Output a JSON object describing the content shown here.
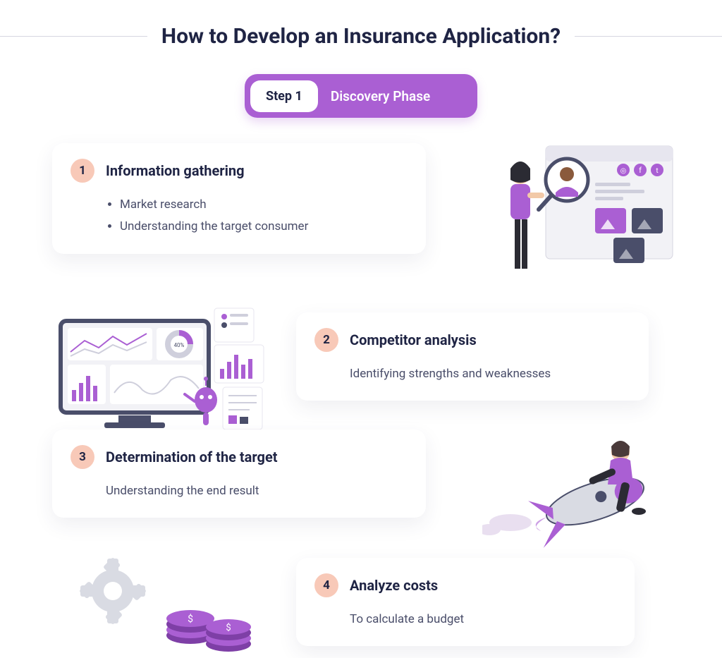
{
  "header": {
    "title": "How to Develop an Insurance Application?"
  },
  "step": {
    "badge": "Step 1",
    "title": "Discovery Phase"
  },
  "colors": {
    "accent": "#aa5fd3",
    "badge": "#f8c9b8",
    "text": "#1f2444",
    "subtext": "#4a4e6a"
  },
  "cards": [
    {
      "num": "1",
      "title": "Information gathering",
      "bullets": [
        "Market research",
        "Understanding the target consumer"
      ],
      "illustration": "profile-research-icon"
    },
    {
      "num": "2",
      "title": "Competitor analysis",
      "desc": "Identifying strengths and weaknesses",
      "illustration": "analytics-dashboard-icon"
    },
    {
      "num": "3",
      "title": "Determination of the target",
      "desc": "Understanding the end result",
      "illustration": "rocket-rider-icon"
    },
    {
      "num": "4",
      "title": "Analyze costs",
      "desc": "To calculate a budget",
      "illustration": "gear-coins-icon"
    }
  ]
}
